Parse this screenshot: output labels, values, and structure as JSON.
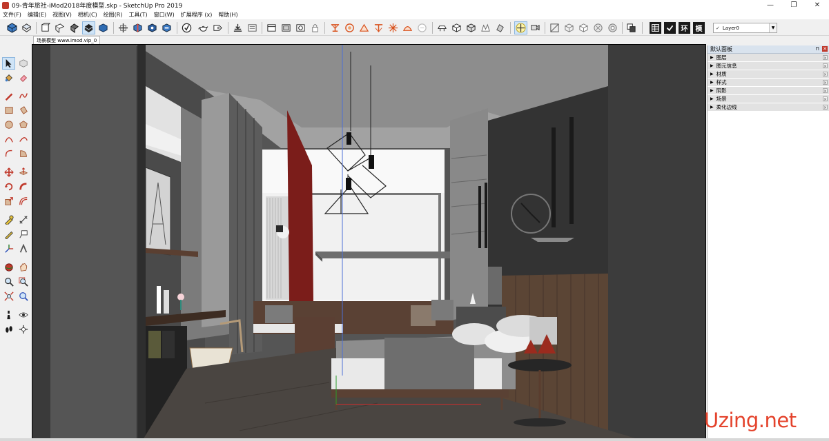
{
  "window": {
    "title": "09-青年旅社-iMod2018年度模型.skp - SketchUp Pro 2019",
    "minimize": "—",
    "maximize": "❐",
    "close": "✕"
  },
  "menu": [
    "文件(F)",
    "编辑(E)",
    "视图(V)",
    "相机(C)",
    "绘图(R)",
    "工具(T)",
    "窗口(W)",
    "扩展程序 (x)",
    "帮助(H)"
  ],
  "toolbar": {
    "layer_check": "✓",
    "layer_value": "Layer0",
    "words": [
      "环",
      "模"
    ]
  },
  "scene_tab": "场景模型 www.imod.vip_0",
  "tray": {
    "title": "默认面板",
    "items": [
      "图层",
      "图元信息",
      "材质",
      "样式",
      "阴影",
      "场景",
      "柔化边线"
    ]
  },
  "watermark": "Uzing.net",
  "colors": {
    "accent_red": "#e4432c",
    "panel_bg": "#f0f0f0",
    "active_blue": "#cfe4f7"
  }
}
